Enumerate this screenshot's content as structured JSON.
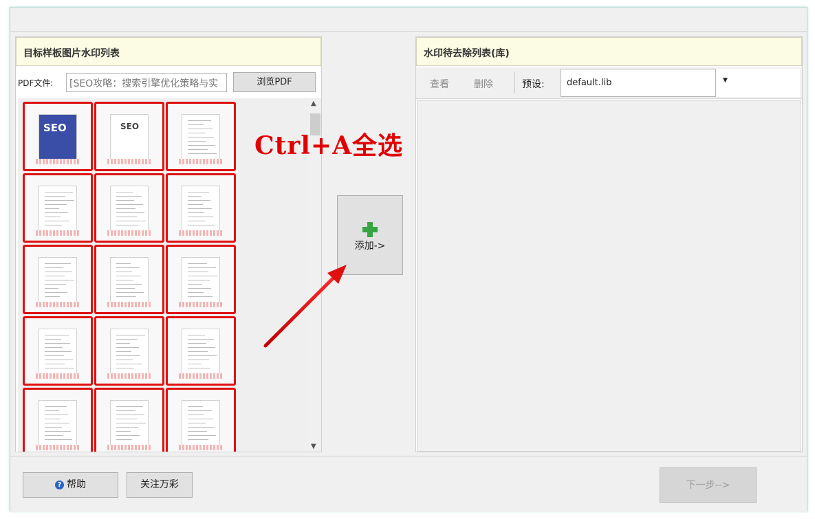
{
  "left_panel": {
    "title": "目标样板图片水印列表",
    "pdf_label": "PDF文件:",
    "pdf_path_value": "[SEO攻略：搜索引擎优化策略与实",
    "browse_label": "浏览PDF",
    "thumbnail_count": 15,
    "cover_titles": [
      "SEO",
      "SEO"
    ]
  },
  "annotation": {
    "hint_text": "Ctrl+A全选",
    "hint_color": "#e00000"
  },
  "middle": {
    "add_label": "添加->",
    "add_icon": "plus-icon"
  },
  "right_panel": {
    "title": "水印待去除列表(库)",
    "view_label": "查看",
    "delete_label": "删除",
    "preset_label": "预设:",
    "preset_value": "default.lib"
  },
  "bottom": {
    "help_label": "帮助",
    "follow_label": "关注万彩",
    "next_label": "下一步-->"
  },
  "colors": {
    "selection_border": "#e01010",
    "panel_header_bg": "#fcfbe3",
    "accent_green": "#36a540"
  }
}
